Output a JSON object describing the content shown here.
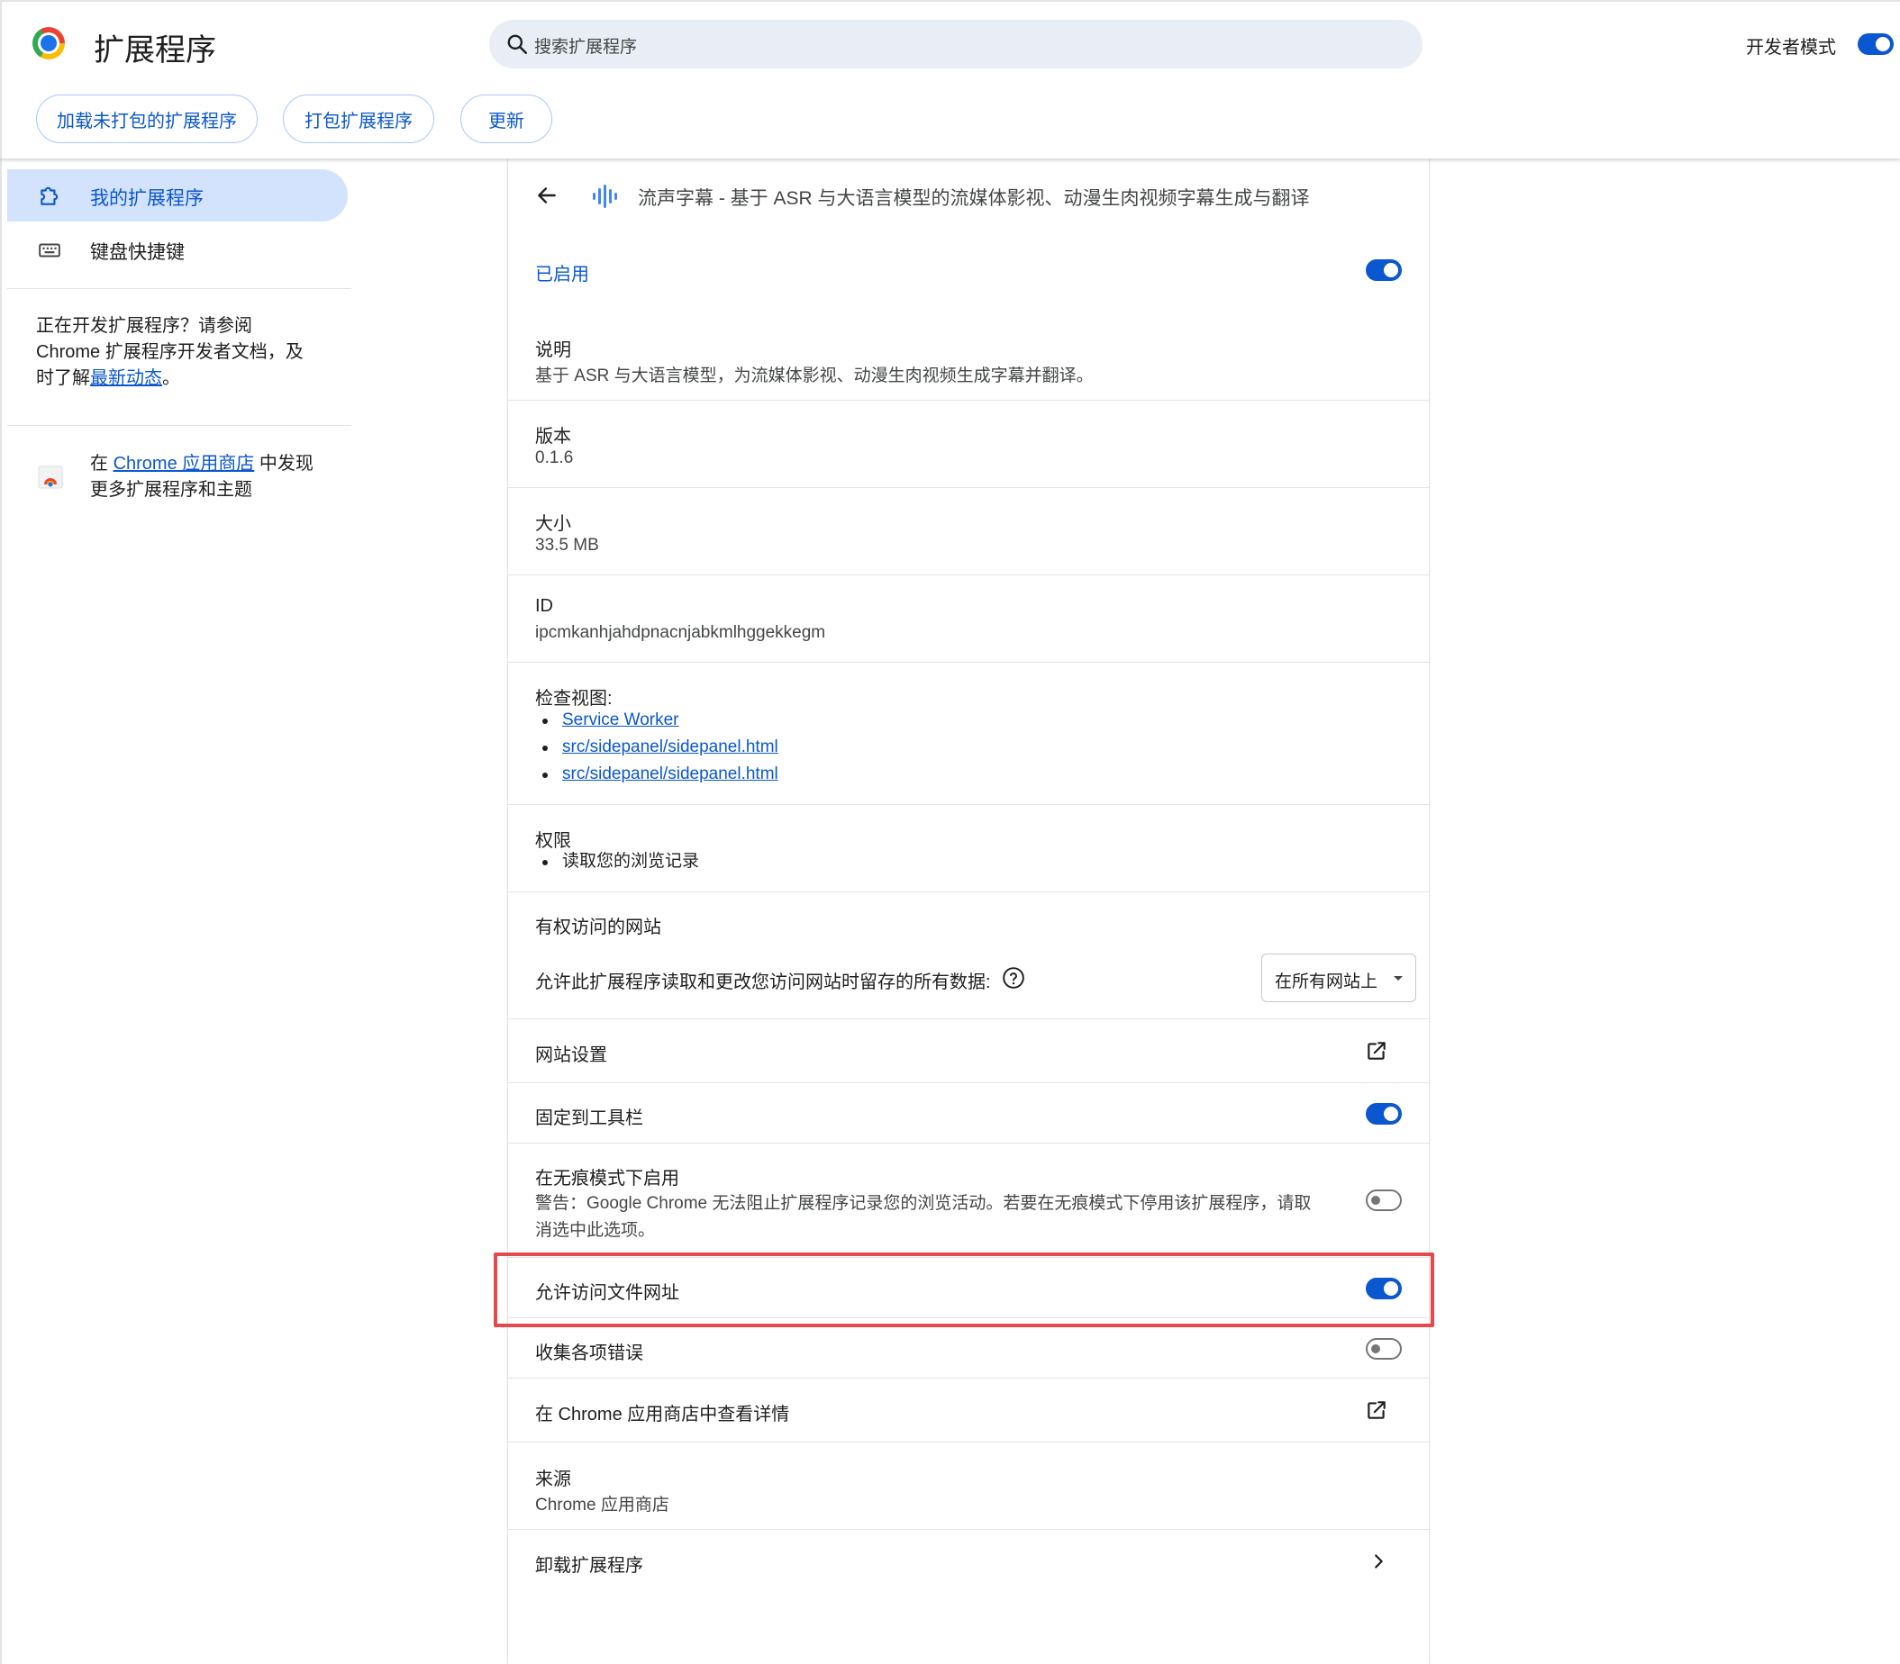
{
  "header": {
    "title": "扩展程序",
    "search_placeholder": "搜索扩展程序",
    "developer_mode_label": "开发者模式",
    "developer_mode_on": true,
    "buttons": {
      "load_unpacked": "加载未打包的扩展程序",
      "pack": "打包扩展程序",
      "update": "更新"
    }
  },
  "sidebar": {
    "items": [
      {
        "label": "我的扩展程序",
        "icon": "puzzle-icon",
        "active": true
      },
      {
        "label": "键盘快捷键",
        "icon": "keyboard-icon",
        "active": false
      }
    ],
    "dev_text_1": "正在开发扩展程序？请参阅 Chrome 扩展程序开发者文档，及时了解",
    "dev_link": "最新动态",
    "dev_text_2": "。",
    "store_prefix": "在 ",
    "store_link": "Chrome 应用商店",
    "store_suffix": " 中发现更多扩展程序和主题"
  },
  "details": {
    "title": "流声字幕 - 基于 ASR 与大语言模型的流媒体影视、动漫生肉视频字幕生成与翻译",
    "enabled_label": "已启用",
    "enabled": true,
    "description_label": "说明",
    "description": "基于 ASR 与大语言模型，为流媒体影视、动漫生肉视频生成字幕并翻译。",
    "version_label": "版本",
    "version": "0.1.6",
    "size_label": "大小",
    "size": "33.5 MB",
    "id_label": "ID",
    "id": "ipcmkanhjahdpnacnjabkmlhggekkegm",
    "inspect_label": "检查视图:",
    "inspect_views": [
      "Service Worker",
      "src/sidepanel/sidepanel.html",
      "src/sidepanel/sidepanel.html"
    ],
    "permissions_label": "权限",
    "permissions": [
      "读取您的浏览记录"
    ],
    "site_access_label": "有权访问的网站",
    "site_access_desc": "允许此扩展程序读取和更改您访问网站时留存的所有数据:",
    "site_access_value": "在所有网站上",
    "site_settings_label": "网站设置",
    "pin_label": "固定到工具栏",
    "pin_on": true,
    "incognito_label": "在无痕模式下启用",
    "incognito_warning": "警告：Google Chrome 无法阻止扩展程序记录您的浏览活动。若要在无痕模式下停用该扩展程序，请取消选中此选项。",
    "incognito_on": false,
    "file_urls_label": "允许访问文件网址",
    "file_urls_on": true,
    "collect_errors_label": "收集各项错误",
    "collect_errors_on": false,
    "store_details_label": "在 Chrome 应用商店中查看详情",
    "source_label": "来源",
    "source": "Chrome 应用商店",
    "remove_label": "卸载扩展程序"
  },
  "colors": {
    "accent": "#0b57d0",
    "active_nav_bg": "#d3e3fd",
    "search_bg": "#e9eef6",
    "highlight_box": "#e5484d"
  }
}
